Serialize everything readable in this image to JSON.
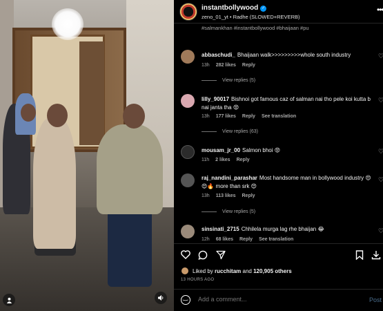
{
  "post": {
    "account": "instantbollywood",
    "subline": "zeno_01_yt • Radhe (SLOWED+REVERB)",
    "caption_tail": "#salmankhan #instantbollywood #bhaijaan #pu"
  },
  "comments": [
    {
      "user": "abbaschudi_",
      "text": "Bhaijaan walk>>>>>>>>>whole south industry",
      "time": "13h",
      "likes": "282 likes",
      "reply": "Reply",
      "translate": "",
      "view_replies": "View replies (5)",
      "avatar_color": "#a07a5a"
    },
    {
      "user": "lilly_90017",
      "text": "Bishnoi got famous caz of salman nai tho pele koi kutta b nai janta tha 😡",
      "time": "13h",
      "likes": "177 likes",
      "reply": "Reply",
      "translate": "See translation",
      "view_replies": "View replies (63)",
      "avatar_color": "#d9a8b0"
    },
    {
      "user": "mousam_jr_00",
      "text": "Salmon bhoi 😡",
      "time": "11h",
      "likes": "2 likes",
      "reply": "Reply",
      "translate": "",
      "view_replies": "",
      "avatar_color": "#2b2b2b"
    },
    {
      "user": "raj_nandini_parashar",
      "text": "Most handsome man in bollywood industry 😍😍🔥 more than srk 😍",
      "time": "13h",
      "likes": "113 likes",
      "reply": "Reply",
      "translate": "",
      "view_replies": "View replies (5)",
      "avatar_color": "#555555"
    },
    {
      "user": "sinsinati_2715",
      "text": "Chhilela murga lag rhe bhaijan 😂",
      "time": "12h",
      "likes": "68 likes",
      "reply": "Reply",
      "translate": "See translation",
      "view_replies": "",
      "avatar_color": "#9a8a7a"
    }
  ],
  "likes_summary": {
    "prefix": "Liked by",
    "user": "rucchitam",
    "connector": "and",
    "count": "120,905 others"
  },
  "timestamp": "13 HOURS AGO",
  "add_comment": {
    "placeholder": "Add a comment...",
    "post_label": "Post"
  },
  "icons": {
    "verified": "verified-badge-icon",
    "more": "more-options-icon",
    "heart": "heart-icon",
    "comment": "comment-icon",
    "share": "share-icon",
    "save": "bookmark-icon",
    "download": "download-icon",
    "emoji": "emoji-icon",
    "user": "user-tag-icon",
    "mute": "mute-icon"
  },
  "colors": {
    "accent": "#0095f6",
    "post_button": "#4a6d8c",
    "secondary_text": "#a8a8a8"
  }
}
